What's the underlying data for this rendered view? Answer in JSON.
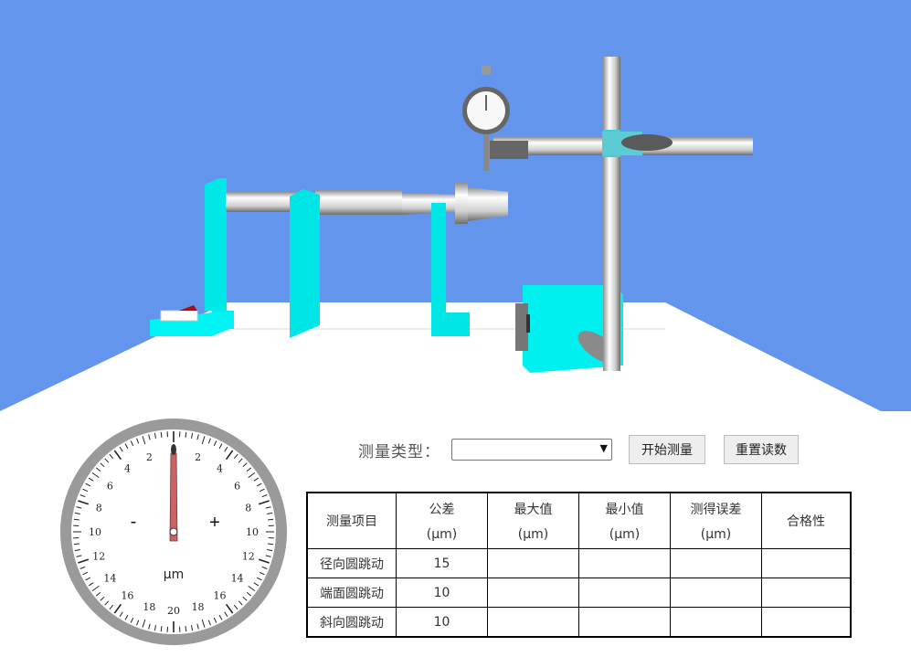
{
  "dial": {
    "minus": "-",
    "plus": "+",
    "unit": "μm",
    "left_labels": [
      "2",
      "4",
      "6",
      "8",
      "10",
      "12",
      "14",
      "16",
      "18"
    ],
    "right_labels": [
      "2",
      "4",
      "6",
      "8",
      "10",
      "12",
      "14",
      "16",
      "18"
    ],
    "bottom_label": "20",
    "pointer_value": 0
  },
  "controls": {
    "type_label": "测量类型：",
    "type_value": "",
    "start_label": "开始测量",
    "reset_label": "重置读数"
  },
  "table": {
    "headers": [
      {
        "title": "测量项目",
        "unit": ""
      },
      {
        "title": "公差",
        "unit": "(μm)"
      },
      {
        "title": "最大值",
        "unit": "(μm)"
      },
      {
        "title": "最小值",
        "unit": "(μm)"
      },
      {
        "title": "测得误差",
        "unit": "(μm)"
      },
      {
        "title": "合格性",
        "unit": ""
      }
    ],
    "rows": [
      [
        "径向圆跳动",
        "15",
        "",
        "",
        "",
        ""
      ],
      [
        "端面圆跳动",
        "10",
        "",
        "",
        "",
        ""
      ],
      [
        "斜向圆跳动",
        "10",
        "",
        "",
        "",
        ""
      ]
    ]
  },
  "colors": {
    "sky": "#6495ED",
    "fixture": "#00FFFF",
    "floor": "#FFFFFF",
    "pointer": "#C86464"
  }
}
